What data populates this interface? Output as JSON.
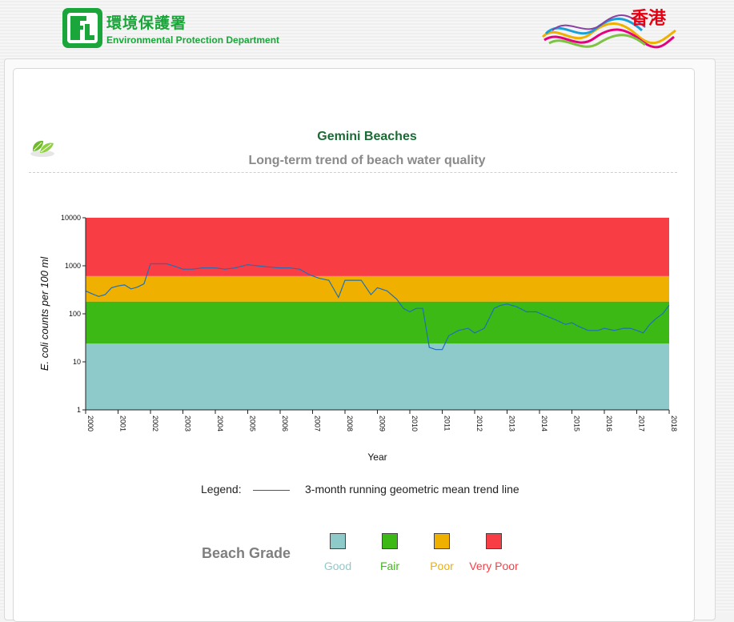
{
  "header": {
    "org_name_cn": "環境保護署",
    "org_name_en": "Environmental Protection Department",
    "brand_cn": "香港"
  },
  "page": {
    "title": "Gemini Beaches",
    "subtitle": "Long-term trend of beach water quality"
  },
  "legend": {
    "label": "Legend:",
    "line_text": "3-month running geometric mean trend line"
  },
  "beach_grade": {
    "title": "Beach Grade",
    "grades": [
      {
        "name": "Good",
        "color": "#8ecaca"
      },
      {
        "name": "Fair",
        "color": "#3cb914"
      },
      {
        "name": "Poor",
        "color": "#f0b000"
      },
      {
        "name": "Very Poor",
        "color": "#f93d44"
      }
    ]
  },
  "colors": {
    "line": "#1f6fb8",
    "good": "#8ecaca",
    "fair": "#3cb914",
    "poor": "#f0b000",
    "very_poor": "#f93d44",
    "title_green": "#1b6b35",
    "logo_green": "#1aa63a"
  },
  "chart_data": {
    "type": "line",
    "xlabel": "Year",
    "ylabel": "E. coli counts per 100 ml",
    "y_scale": "log",
    "xlim": [
      2000,
      2018
    ],
    "ylim": [
      1,
      10000
    ],
    "x_ticks": [
      "2000",
      "2001",
      "2002",
      "2003",
      "2004",
      "2005",
      "2006",
      "2007",
      "2008",
      "2009",
      "2010",
      "2011",
      "2012",
      "2013",
      "2014",
      "2015",
      "2016",
      "2017",
      "2018"
    ],
    "y_ticks": [
      "1",
      "10",
      "100",
      "1000",
      "10000"
    ],
    "grade_bands": [
      {
        "name": "Good",
        "from": 1,
        "to": 24
      },
      {
        "name": "Fair",
        "from": 24,
        "to": 180
      },
      {
        "name": "Poor",
        "from": 180,
        "to": 610
      },
      {
        "name": "Very Poor",
        "from": 610,
        "to": 10000
      }
    ],
    "series": [
      {
        "x": [
          2000.0,
          2000.2,
          2000.4,
          2000.6,
          2000.8,
          2001.0,
          2001.2,
          2001.4,
          2001.6,
          2001.8,
          2002.0,
          2002.2,
          2002.5,
          2002.8,
          2003.0,
          2003.3,
          2003.6,
          2004.0,
          2004.3,
          2004.6,
          2005.0,
          2005.3,
          2005.6,
          2006.0,
          2006.3,
          2006.6,
          2006.9,
          2007.2,
          2007.5,
          2007.8,
          2008.0,
          2008.3,
          2008.5,
          2008.8,
          2009.0,
          2009.3,
          2009.6,
          2009.8,
          2010.0,
          2010.2,
          2010.4,
          2010.6,
          2010.8,
          2011.0,
          2011.2,
          2011.5,
          2011.8,
          2012.0,
          2012.3,
          2012.6,
          2012.8,
          2013.0,
          2013.3,
          2013.6,
          2013.9,
          2014.2,
          2014.5,
          2014.8,
          2015.0,
          2015.2,
          2015.5,
          2015.8,
          2016.0,
          2016.3,
          2016.6,
          2016.8,
          2017.0,
          2017.2,
          2017.4,
          2017.6,
          2017.8,
          2018.0
        ],
        "y": [
          300,
          260,
          230,
          250,
          350,
          380,
          400,
          330,
          360,
          420,
          1100,
          1100,
          1100,
          950,
          850,
          850,
          900,
          900,
          850,
          900,
          1050,
          1000,
          950,
          900,
          900,
          850,
          650,
          550,
          500,
          220,
          500,
          500,
          500,
          250,
          350,
          300,
          200,
          130,
          110,
          130,
          130,
          20,
          18,
          18,
          35,
          45,
          50,
          40,
          50,
          130,
          150,
          160,
          140,
          110,
          110,
          90,
          75,
          60,
          65,
          55,
          45,
          45,
          50,
          45,
          50,
          50,
          45,
          40,
          60,
          80,
          100,
          150
        ]
      }
    ]
  }
}
